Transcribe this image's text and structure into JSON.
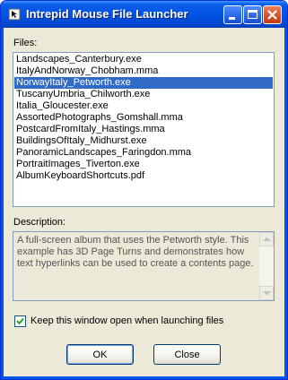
{
  "window": {
    "title": "Intrepid Mouse File Launcher"
  },
  "files": {
    "label": "Files:",
    "items": [
      "Landscapes_Canterbury.exe",
      "ItalyAndNorway_Chobham.mma",
      "NorwayItaly_Petworth.exe",
      "TuscanyUmbria_Chilworth.exe",
      "Italia_Gloucester.exe",
      "AssortedPhotographs_Gomshall.mma",
      "PostcardFromItaly_Hastings.mma",
      "BuildingsOfItaly_Midhurst.exe",
      "PanoramicLandscapes_Faringdon.mma",
      "PortraitImages_Tiverton.exe",
      "AlbumKeyboardShortcuts.pdf"
    ],
    "selected": "NorwayItaly_Petworth.exe"
  },
  "description": {
    "label": "Description:",
    "text": "A full-screen album that uses the Petworth style. This example has 3D Page Turns and demonstrates how text hyperlinks can be used to create a contents page."
  },
  "keep_open": {
    "label": "Keep this window open when launching files",
    "checked": true
  },
  "buttons": {
    "ok": "OK",
    "close": "Close"
  },
  "icons": {
    "app": "mouse-app-icon",
    "minimize": "minimize-icon",
    "maximize": "maximize-icon",
    "close": "close-icon",
    "scroll_up": "scroll-up-arrow-icon",
    "scroll_down": "scroll-down-arrow-icon",
    "check": "checkmark-icon"
  },
  "colors": {
    "titlebar": "#0054e3",
    "selection": "#316ac5",
    "close_button": "#d8502a"
  }
}
